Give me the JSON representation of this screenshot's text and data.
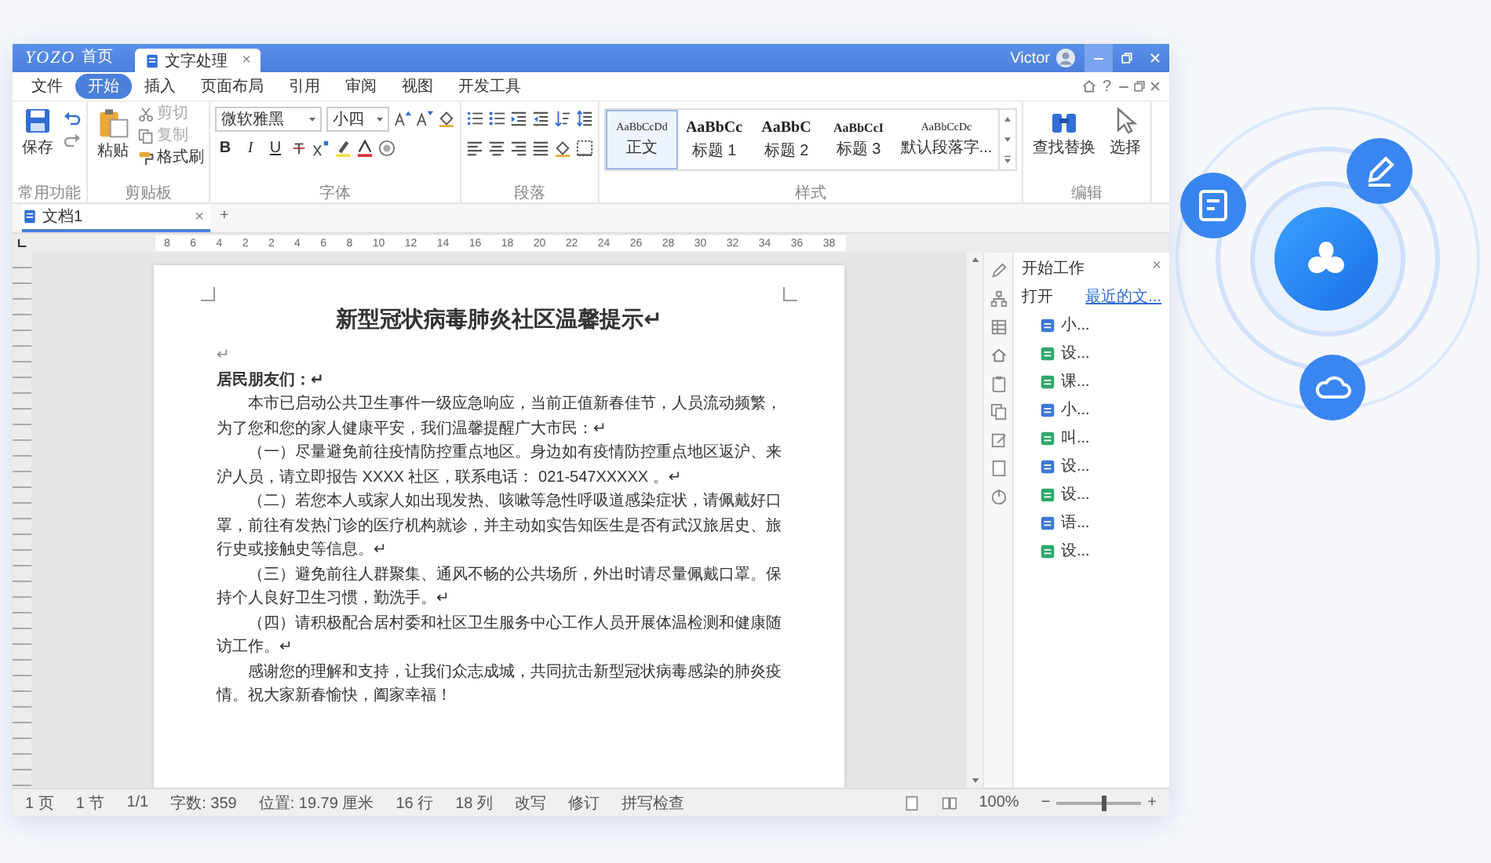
{
  "titlebar": {
    "logo": "YOZO",
    "home": "首页",
    "tabs": [
      {
        "label": "文字处理",
        "close": "×",
        "selected": true
      }
    ],
    "user": "Victor"
  },
  "menu": {
    "items": [
      {
        "label": "文件",
        "selected": false
      },
      {
        "label": "开始",
        "selected": true
      },
      {
        "label": "插入",
        "selected": false
      },
      {
        "label": "页面布局",
        "selected": false
      },
      {
        "label": "引用",
        "selected": false
      },
      {
        "label": "审阅",
        "selected": false
      },
      {
        "label": "视图",
        "selected": false
      },
      {
        "label": "开发工具",
        "selected": false
      }
    ],
    "help": "?"
  },
  "ribbon": {
    "groups": [
      {
        "kind": "quick",
        "label": "常用功能",
        "buttons": [
          {
            "label": "保存",
            "disabled": false
          }
        ]
      },
      {
        "kind": "clipboard",
        "label": "剪贴板",
        "buttons": [
          {
            "label": "粘贴",
            "disabled": false
          },
          {
            "label": "剪切",
            "disabled": true
          },
          {
            "label": "复制",
            "disabled": true
          },
          {
            "label": "格式刷",
            "disabled": false
          }
        ]
      },
      {
        "kind": "font",
        "label": "字体",
        "font": "微软雅黑",
        "size": "小四",
        "buttons": [
          {
            "label": "B",
            "disabled": false
          },
          {
            "label": "I",
            "disabled": false
          },
          {
            "label": "U",
            "disabled": false
          }
        ]
      },
      {
        "kind": "paragraph",
        "label": "段落"
      },
      {
        "kind": "styles",
        "label": "样式",
        "items": [
          {
            "sample": "AaBbCcDd",
            "name": "正文",
            "selected": true
          },
          {
            "sample": "AaBbCc",
            "name": "标题 1",
            "selected": false
          },
          {
            "sample": "AaBbC",
            "name": "标题 2",
            "selected": false
          },
          {
            "sample": "AaBbCcI",
            "name": "标题 3",
            "selected": false
          },
          {
            "sample": "AaBbCcDc",
            "name": "默认段落字...",
            "selected": false
          }
        ]
      },
      {
        "kind": "edit",
        "label": "编辑",
        "buttons": [
          {
            "label": "查找替换",
            "disabled": false
          },
          {
            "label": "选择",
            "disabled": false
          }
        ]
      }
    ]
  },
  "doc_tabs": {
    "tabs": [
      {
        "label": "文档1",
        "close": "×",
        "selected": true
      }
    ],
    "new_tab": "+"
  },
  "ruler": {
    "ticks": [
      "8",
      "6",
      "4",
      "2",
      "2",
      "4",
      "6",
      "8",
      "10",
      "12",
      "14",
      "16",
      "18",
      "20",
      "22",
      "24",
      "26",
      "28",
      "30",
      "32",
      "34",
      "36",
      "38"
    ]
  },
  "document": {
    "title": "新型冠状病毒肺炎社区温馨提示↵",
    "paragraphs": [
      {
        "kind": "blank",
        "text": "↵"
      },
      {
        "kind": "salutation",
        "text": "居民朋友们：↵"
      },
      {
        "kind": "body",
        "text": "本市已启动公共卫生事件一级应急响应，当前正值新春佳节，人员流动频繁，为了您和您的家人健康平安，我们温馨提醒广大市民：↵"
      },
      {
        "kind": "body",
        "text": "（一）尽量避免前往疫情防控重点地区。身边如有疫情防控重点地区返沪、来沪人员，请立即报告 XXXX 社区，联系电话： 021-547XXXXX 。↵"
      },
      {
        "kind": "body",
        "text": "（二）若您本人或家人如出现发热、咳嗽等急性呼吸道感染症状，请佩戴好口罩，前往有发热门诊的医疗机构就诊，并主动如实告知医生是否有武汉旅居史、旅行史或接触史等信息。↵"
      },
      {
        "kind": "body",
        "text": "（三）避免前往人群聚集、通风不畅的公共场所，外出时请尽量佩戴口罩。保持个人良好卫生习惯，勤洗手。↵"
      },
      {
        "kind": "body",
        "text": "（四）请积极配合居村委和社区卫生服务中心工作人员开展体温检测和健康随访工作。↵"
      },
      {
        "kind": "body",
        "text": "感谢您的理解和支持，让我们众志成城，共同抗击新型冠状病毒感染的肺炎疫情。祝大家新春愉快，阖家幸福！"
      }
    ]
  },
  "panel": {
    "title": "开始工作",
    "close": "×",
    "open": "打开",
    "recent": "最近的文...",
    "files": [
      {
        "name": "小...",
        "kind": "doc"
      },
      {
        "name": "设...",
        "kind": "sheet"
      },
      {
        "name": "课...",
        "kind": "sheet"
      },
      {
        "name": "小...",
        "kind": "doc"
      },
      {
        "name": "叫...",
        "kind": "sheet"
      },
      {
        "name": "设...",
        "kind": "doc"
      },
      {
        "name": "设...",
        "kind": "sheet"
      },
      {
        "name": "语...",
        "kind": "doc"
      },
      {
        "name": "设...",
        "kind": "sheet"
      }
    ]
  },
  "status_bar": {
    "items": [
      "1 页",
      "1 节",
      "1/1",
      "字数: 359",
      "位置: 19.79 厘米",
      "16 行",
      "18 列",
      "改写",
      "修订",
      "拼写检查"
    ],
    "zoom": {
      "value": "100%",
      "minus": "−",
      "plus": "+",
      "level": 0.55
    }
  }
}
